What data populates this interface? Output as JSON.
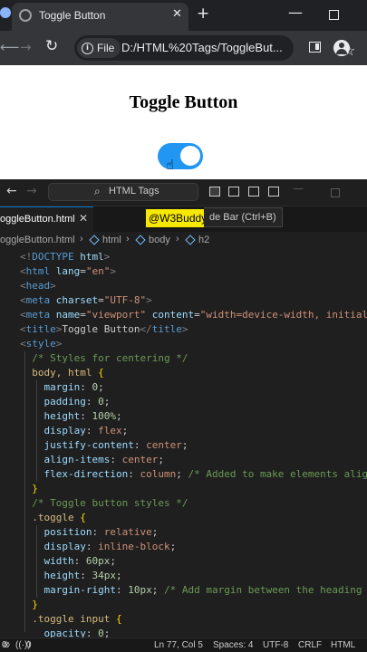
{
  "browser": {
    "tab_title": "Toggle Button",
    "tab_close": "✕",
    "new_tab": "+",
    "chip_label": "File",
    "url": "D:/HTML%20Tags/ToggleBut..."
  },
  "webpage": {
    "heading": "Toggle Button",
    "toggle_checked": true,
    "accent_color": "#2196f3"
  },
  "vscode": {
    "search_text": "HTML Tags",
    "tab_label": "oggleButton.html",
    "tab_close": "✕",
    "watermark": "@W3Buddy",
    "tooltip": "de Bar (Ctrl+B)",
    "breadcrumbs": [
      "oggleButton.html",
      "html",
      "body",
      "h2"
    ],
    "code_lines": [
      [
        [
          "t-tag",
          "<!"
        ],
        [
          "t-name",
          "DOCTYPE"
        ],
        [
          "t-text",
          " "
        ],
        [
          "t-attr",
          "html"
        ],
        [
          "t-tag",
          ">"
        ]
      ],
      [
        [
          "t-tag",
          "<"
        ],
        [
          "t-name",
          "html"
        ],
        [
          "t-text",
          " "
        ],
        [
          "t-attr",
          "lang"
        ],
        [
          "t-punc",
          "="
        ],
        [
          "t-str",
          "\"en\""
        ],
        [
          "t-tag",
          ">"
        ]
      ],
      [
        [
          "t-tag",
          "<"
        ],
        [
          "t-name",
          "head"
        ],
        [
          "t-tag",
          ">"
        ]
      ],
      [
        [
          "t-tag",
          "<"
        ],
        [
          "t-name",
          "meta"
        ],
        [
          "t-text",
          " "
        ],
        [
          "t-attr",
          "charset"
        ],
        [
          "t-punc",
          "="
        ],
        [
          "t-str",
          "\"UTF-8\""
        ],
        [
          "t-tag",
          ">"
        ]
      ],
      [
        [
          "t-tag",
          "<"
        ],
        [
          "t-name",
          "meta"
        ],
        [
          "t-text",
          " "
        ],
        [
          "t-attr",
          "name"
        ],
        [
          "t-punc",
          "="
        ],
        [
          "t-str",
          "\"viewport\""
        ],
        [
          "t-text",
          " "
        ],
        [
          "t-attr",
          "content"
        ],
        [
          "t-punc",
          "="
        ],
        [
          "t-str",
          "\"width=device-width, initial-s"
        ]
      ],
      [
        [
          "t-tag",
          "<"
        ],
        [
          "t-name",
          "title"
        ],
        [
          "t-tag",
          ">"
        ],
        [
          "t-text",
          "Toggle Button"
        ],
        [
          "t-tag",
          "</"
        ],
        [
          "t-name",
          "title"
        ],
        [
          "t-tag",
          ">"
        ]
      ],
      [
        [
          "t-tag",
          "<"
        ],
        [
          "t-name",
          "style"
        ],
        [
          "t-tag",
          ">"
        ]
      ],
      [
        [
          "t-text",
          "  "
        ],
        [
          "t-cmt",
          "/* Styles for centering */"
        ]
      ],
      [
        [
          "t-text",
          "  "
        ],
        [
          "t-sel",
          "body, html"
        ],
        [
          "t-text",
          " "
        ],
        [
          "t-brace",
          "{"
        ]
      ],
      [
        [
          "t-text",
          "    "
        ],
        [
          "t-prop",
          "margin"
        ],
        [
          "t-punc",
          ": "
        ],
        [
          "t-num",
          "0"
        ],
        [
          "t-punc",
          ";"
        ]
      ],
      [
        [
          "t-text",
          "    "
        ],
        [
          "t-prop",
          "padding"
        ],
        [
          "t-punc",
          ": "
        ],
        [
          "t-num",
          "0"
        ],
        [
          "t-punc",
          ";"
        ]
      ],
      [
        [
          "t-text",
          "    "
        ],
        [
          "t-prop",
          "height"
        ],
        [
          "t-punc",
          ": "
        ],
        [
          "t-num",
          "100%"
        ],
        [
          "t-punc",
          ";"
        ]
      ],
      [
        [
          "t-text",
          "    "
        ],
        [
          "t-prop",
          "display"
        ],
        [
          "t-punc",
          ": "
        ],
        [
          "t-val",
          "flex"
        ],
        [
          "t-punc",
          ";"
        ]
      ],
      [
        [
          "t-text",
          "    "
        ],
        [
          "t-prop",
          "justify-content"
        ],
        [
          "t-punc",
          ": "
        ],
        [
          "t-val",
          "center"
        ],
        [
          "t-punc",
          ";"
        ]
      ],
      [
        [
          "t-text",
          "    "
        ],
        [
          "t-prop",
          "align-items"
        ],
        [
          "t-punc",
          ": "
        ],
        [
          "t-val",
          "center"
        ],
        [
          "t-punc",
          ";"
        ]
      ],
      [
        [
          "t-text",
          "    "
        ],
        [
          "t-prop",
          "flex-direction"
        ],
        [
          "t-punc",
          ": "
        ],
        [
          "t-val",
          "column"
        ],
        [
          "t-punc",
          "; "
        ],
        [
          "t-cmt",
          "/* Added to make elements align"
        ]
      ],
      [
        [
          "t-text",
          "  "
        ],
        [
          "t-brace",
          "}"
        ]
      ],
      [
        [
          "t-text",
          "  "
        ],
        [
          "t-cmt",
          "/* Toggle button styles */"
        ]
      ],
      [
        [
          "t-text",
          "  "
        ],
        [
          "t-sel",
          ".toggle"
        ],
        [
          "t-text",
          " "
        ],
        [
          "t-brace",
          "{"
        ]
      ],
      [
        [
          "t-text",
          "    "
        ],
        [
          "t-prop",
          "position"
        ],
        [
          "t-punc",
          ": "
        ],
        [
          "t-val",
          "relative"
        ],
        [
          "t-punc",
          ";"
        ]
      ],
      [
        [
          "t-text",
          "    "
        ],
        [
          "t-prop",
          "display"
        ],
        [
          "t-punc",
          ": "
        ],
        [
          "t-val",
          "inline-block"
        ],
        [
          "t-punc",
          ";"
        ]
      ],
      [
        [
          "t-text",
          "    "
        ],
        [
          "t-prop",
          "width"
        ],
        [
          "t-punc",
          ": "
        ],
        [
          "t-num",
          "60px"
        ],
        [
          "t-punc",
          ";"
        ]
      ],
      [
        [
          "t-text",
          "    "
        ],
        [
          "t-prop",
          "height"
        ],
        [
          "t-punc",
          ": "
        ],
        [
          "t-num",
          "34px"
        ],
        [
          "t-punc",
          ";"
        ]
      ],
      [
        [
          "t-text",
          "    "
        ],
        [
          "t-prop",
          "margin-right"
        ],
        [
          "t-punc",
          ": "
        ],
        [
          "t-num",
          "10px"
        ],
        [
          "t-punc",
          "; "
        ],
        [
          "t-cmt",
          "/* Add margin between the heading an"
        ]
      ],
      [
        [
          "t-text",
          "  "
        ],
        [
          "t-brace",
          "}"
        ]
      ],
      [
        [
          "t-text",
          "  "
        ],
        [
          "t-sel",
          ".toggle input"
        ],
        [
          "t-text",
          " "
        ],
        [
          "t-brace",
          "{"
        ]
      ],
      [
        [
          "t-text",
          "    "
        ],
        [
          "t-prop",
          "opacity"
        ],
        [
          "t-punc",
          ": "
        ],
        [
          "t-num",
          "0"
        ],
        [
          "t-punc",
          ";"
        ]
      ]
    ],
    "status": {
      "errors": "0",
      "radio": "0",
      "position": "Ln 77, Col 5",
      "spaces": "Spaces: 4",
      "encoding": "UTF-8",
      "eol": "CRLF",
      "language": "HTML"
    }
  }
}
